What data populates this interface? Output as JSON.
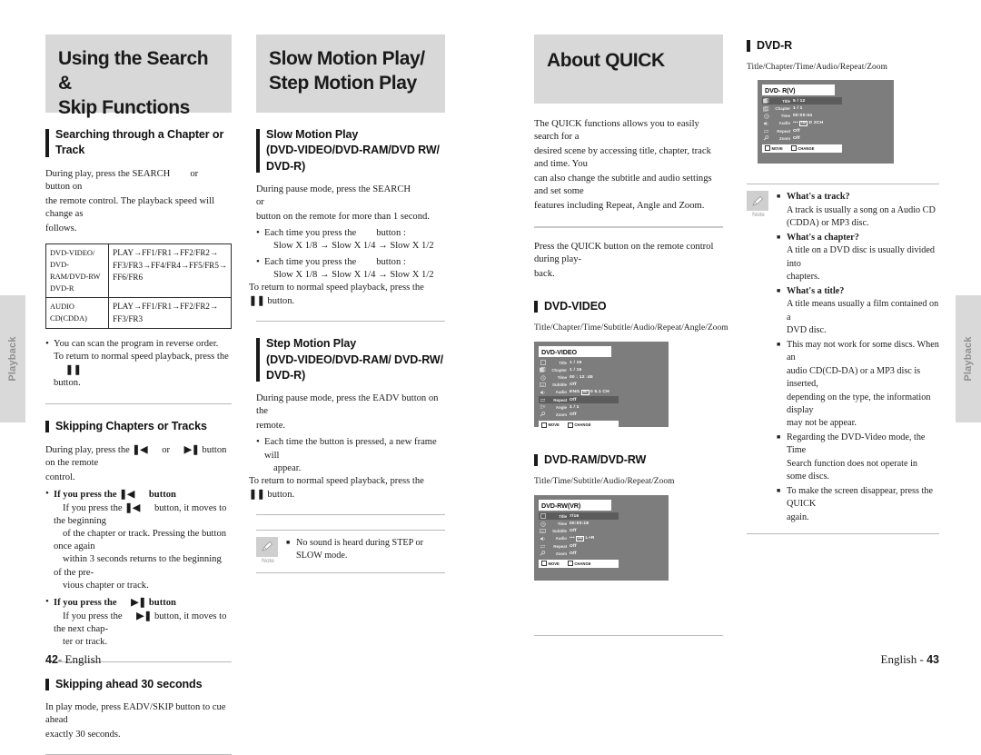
{
  "side_tabs": {
    "left_label": "Playback",
    "right_label": "Playback"
  },
  "page_left": {
    "banner": {
      "line1": "Using the Search &",
      "line2": "Skip Functions"
    },
    "section1": {
      "heading_line1": "Searching through a Chapter or",
      "heading_line2": "Track",
      "intro_a": "During play, press the SEARCH",
      "intro_or": "or",
      "intro_b": "button on",
      "intro_c": "the remote control. The playback speed will change as",
      "intro_d": "follows.",
      "table": {
        "rows": [
          {
            "label_lines": [
              "DVD-VIDEO/",
              "DVD-RAM/DVD-RW",
              "DVD-R"
            ],
            "value_lines": [
              "PLAY→FF1/FR1→FF2/FR2→",
              "FF3/FR3→FF4/FR4→FF5/FR5→",
              "FF6/FR6"
            ]
          },
          {
            "label_lines": [
              "AUDIO CD(CDDA)"
            ],
            "value_lines": [
              "PLAY→FF1/FR1→FF2/FR2→",
              "FF3/FR3"
            ]
          }
        ]
      },
      "bullet_1a": "You can scan the program in reverse order.",
      "bullet_1b": "To return to normal speed playback, press the",
      "bullet_1c": "button."
    },
    "section2": {
      "heading": "Skipping Chapters or Tracks",
      "intro_a": "During play, press the",
      "intro_or": "or",
      "intro_b": "button on the remote",
      "intro_c": "control.",
      "b1_title_a": "If you press the",
      "b1_title_b": "button",
      "b1_l1_a": "If you press the",
      "b1_l1_b": "button, it moves to the beginning",
      "b1_l2": "of the chapter or track. Pressing the button once again",
      "b1_l3": "within 3 seconds returns to the beginning of  the pre-",
      "b1_l4": "vious chapter or track.",
      "b2_title_a": "If you press the",
      "b2_title_b": "button",
      "b2_l1_a": "If you press the",
      "b2_l1_b": "button, it moves to the next chap-",
      "b2_l2": "ter or track."
    },
    "section3": {
      "heading": "Skipping ahead 30 seconds",
      "line1": "In play mode, press EADV/SKIP button to cue ahead",
      "line2": "exactly 30 seconds."
    },
    "footer": {
      "number": "42",
      "dash": "- ",
      "lang": "English"
    }
  },
  "page_mid": {
    "banner": {
      "line1": "Slow Motion Play/",
      "line2": "Step Motion Play"
    },
    "slow": {
      "heading": "Slow Motion Play",
      "heading_sub1": "(DVD-VIDEO/DVD-RAM/DVD RW/",
      "heading_sub2": "DVD-R)",
      "intro_a": "During pause mode, press the SEARCH",
      "intro_or": "or",
      "intro_b": "button on the remote for more than 1 second.",
      "b1_a": "Each time you press the",
      "b1_b": "button :",
      "b1_speeds": "Slow X 1/8 →    Slow X 1/4 →      Slow X 1/2",
      "b2_a": "Each time you press the",
      "b2_b": "button :",
      "b2_speeds": "Slow X 1/8 →    Slow X 1/4 →      Slow X 1/2",
      "return_a": "To return to normal speed playback, press the",
      "return_b": "button."
    },
    "step": {
      "heading": "Step Motion Play",
      "heading_sub1": "(DVD-VIDEO/DVD-RAM/ DVD-RW/",
      "heading_sub2": "DVD-R)",
      "intro_a": "During pause mode, press the EADV button on the",
      "intro_b": "remote.",
      "b1_a": "Each time the button is pressed, a new frame will",
      "b1_b": "appear.",
      "return_a": "To return to normal speed playback, press the",
      "return_b": "button."
    },
    "note": {
      "label": "Note",
      "item1": "No sound is heard during STEP or SLOW mode."
    }
  },
  "page_right_inner": {
    "banner": {
      "line1": "About QUICK"
    },
    "intro": {
      "l1": "The QUICK functions allows you to easily search for a",
      "l2": "desired scene by accessing title, chapter, track and time. You",
      "l3": "can also change the subtitle and audio settings and set some",
      "l4": "features including Repeat, Angle and Zoom."
    },
    "press": {
      "l1": "Press the QUICK button on the remote control during play-",
      "l2": "back."
    },
    "dvd_video": {
      "heading": "DVD-VIDEO",
      "caption": "Title/Chapter/Time/Subtitle/Audio/Repeat/Angle/Zoom",
      "osd": {
        "title": "DVD-VIDEO",
        "rows": [
          {
            "icon": "title-icon",
            "label": "Title",
            "value": "1 / 19",
            "highlight": false
          },
          {
            "icon": "chapter-icon",
            "label": "Chapter",
            "value": "1 / 15",
            "highlight": false
          },
          {
            "icon": "time-icon",
            "label": "Time",
            "value": "00 : 12 :45",
            "highlight": false
          },
          {
            "icon": "subtitle-icon",
            "label": "Subtitle",
            "value": "Off",
            "highlight": false
          },
          {
            "icon": "audio-icon",
            "label": "Audio",
            "value": "ENG",
            "badge": "DD",
            "value2": "0 5.1 CH",
            "highlight": false
          },
          {
            "icon": "repeat-icon",
            "label": "Repeat",
            "value": "Off",
            "highlight": true
          },
          {
            "icon": "angle-icon",
            "label": "Angle",
            "value": "1 / 1",
            "highlight": false
          },
          {
            "icon": "zoom-icon",
            "label": "Zoom",
            "value": "Off",
            "highlight": false
          }
        ],
        "foot_move": "MOVE",
        "foot_change": "CHANGE"
      }
    },
    "dvd_ram": {
      "heading": "DVD-RAM/DVD-RW",
      "caption": "Title/Time/Subtitle/Audio/Repeat/Zoom",
      "osd": {
        "title": "DVD-RW(VR)",
        "rows": [
          {
            "icon": "title-icon",
            "label": "Title",
            "value": "7/16",
            "highlight": true
          },
          {
            "icon": "time-icon",
            "label": "Time",
            "value": "00:00:18",
            "highlight": false
          },
          {
            "icon": "subtitle-icon",
            "label": "Subtitle",
            "value": "Off",
            "highlight": false
          },
          {
            "icon": "audio-icon",
            "label": "Audio",
            "value": "•••",
            "badge": "DD",
            "value2": "L+R",
            "highlight": false
          },
          {
            "icon": "repeat-icon",
            "label": "Repeat",
            "value": "Off",
            "highlight": false
          },
          {
            "icon": "zoom-icon",
            "label": "Zoom",
            "value": "Off",
            "highlight": false
          }
        ],
        "foot_move": "MOVE",
        "foot_change": "CHANGE"
      }
    }
  },
  "page_right": {
    "dvd_r": {
      "heading": "DVD-R",
      "caption": "Title/Chapter/Time/Audio/Repeat/Zoom",
      "osd": {
        "title": "DVD- R(V)",
        "rows": [
          {
            "icon": "title-icon",
            "label": "Title",
            "value": "5 / 12",
            "highlight": true
          },
          {
            "icon": "chapter-icon",
            "label": "Chapter",
            "value": "1 / 1",
            "highlight": false
          },
          {
            "icon": "time-icon",
            "label": "Time",
            "value": "00:00:04",
            "highlight": false
          },
          {
            "icon": "audio-icon",
            "label": "Audio",
            "value": "•••",
            "badge": "DD",
            "value2": "D 2CH",
            "highlight": false
          },
          {
            "icon": "repeat-icon",
            "label": "Repeat",
            "value": "Off",
            "highlight": false
          },
          {
            "icon": "zoom-icon",
            "label": "Zoom",
            "value": "Off",
            "highlight": false
          }
        ],
        "foot_move": "MOVE",
        "foot_change": "CHANGE"
      }
    },
    "note": {
      "label": "Note",
      "items": [
        {
          "q": "What's a track?",
          "a1": "A track is usually a song on a Audio CD",
          "a2": "(CDDA) or MP3 disc."
        },
        {
          "q": "What's a chapter?",
          "a1": "A title on a DVD disc is usually divided into",
          "a2": "chapters."
        },
        {
          "q": "What's a title?",
          "a1": "A title means usually a film contained on a",
          "a2": "DVD disc."
        },
        {
          "q": "",
          "a1": "This may not work for some discs. When an",
          "a2": "audio CD(CD-DA) or a MP3 disc is inserted,",
          "a3": "depending on the type, the information display",
          "a4": "may not be appear."
        },
        {
          "q": "",
          "a1": "Regarding the DVD-Video mode, the Time",
          "a2": "Search function does not operate in some discs."
        },
        {
          "q": "",
          "a1": "To make the screen disappear, press the QUICK",
          "a2": "again."
        }
      ]
    },
    "footer": {
      "lang": "English",
      "dash": " - ",
      "number": "43"
    }
  }
}
